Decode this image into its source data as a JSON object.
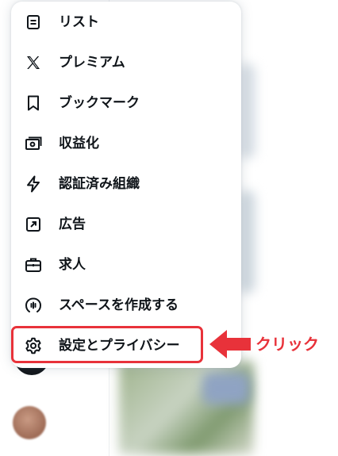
{
  "menu": {
    "items": [
      {
        "label": "リスト",
        "icon": "list-icon"
      },
      {
        "label": "プレミアム",
        "icon": "x-logo-icon"
      },
      {
        "label": "ブックマーク",
        "icon": "bookmark-icon"
      },
      {
        "label": "収益化",
        "icon": "monetization-icon"
      },
      {
        "label": "認証済み組織",
        "icon": "lightning-icon"
      },
      {
        "label": "広告",
        "icon": "ads-icon"
      },
      {
        "label": "求人",
        "icon": "briefcase-icon"
      },
      {
        "label": "スペースを作成する",
        "icon": "spaces-icon"
      },
      {
        "label": "設定とプライバシー",
        "icon": "gear-icon"
      }
    ]
  },
  "annotation": {
    "text": "クリック",
    "color": "#e8323a"
  },
  "colors": {
    "text": "#0f1419",
    "highlight": "#e8323a",
    "menu_background": "#ffffff"
  }
}
